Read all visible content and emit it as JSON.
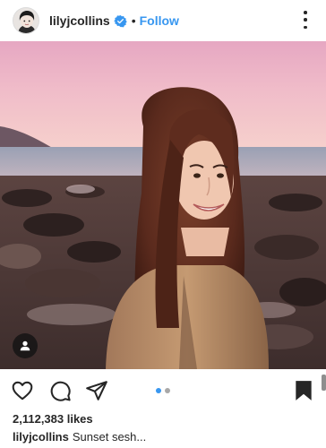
{
  "post": {
    "username": "lilyjcollins",
    "separator": "•",
    "follow_label": "Follow",
    "likes": "2,112,383 likes",
    "caption_user": "lilyjcollins",
    "caption_text": "Sunset sesh..."
  },
  "icons": {
    "verified": "verified-badge-icon",
    "more": "more-options-icon",
    "tag": "user-tag-icon",
    "like": "heart-icon",
    "comment": "comment-icon",
    "share": "send-icon",
    "save": "bookmark-icon"
  },
  "carousel": {
    "count": 2,
    "active": 1
  },
  "colors": {
    "accent": "#3897f0",
    "text": "#262626",
    "pager_active": "#3897f0",
    "pager_inactive": "#a8a8a8"
  }
}
